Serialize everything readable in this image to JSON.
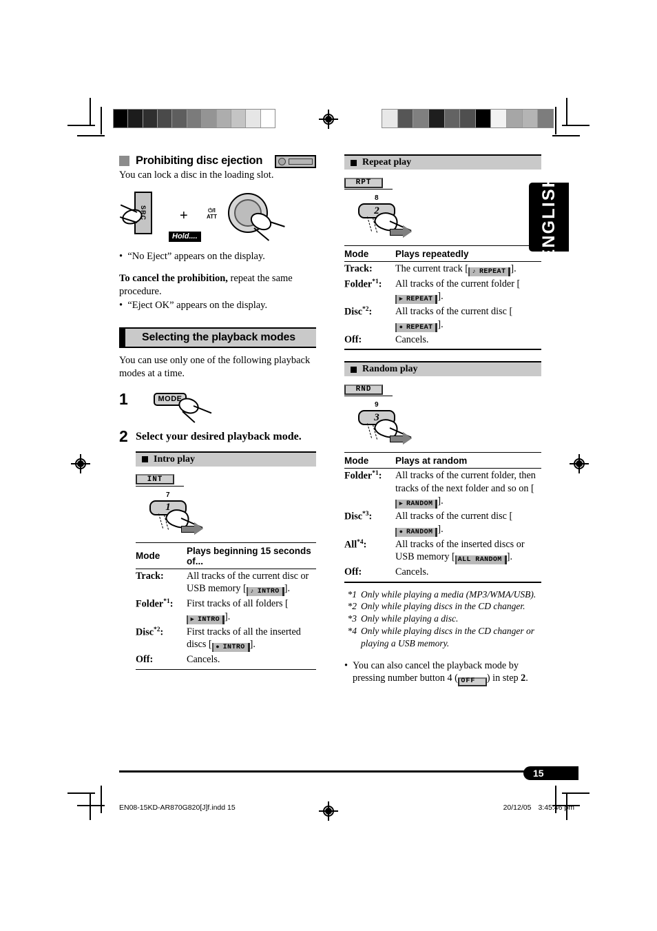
{
  "language_tab": "ENGLISH",
  "page_number": "15",
  "footer": {
    "filename": "EN08-15KD-AR870G820[J]f.indd   15",
    "date": "20/12/05",
    "time": "3:45:46 pm"
  },
  "left_column": {
    "section1": {
      "marker": "gray-square",
      "title": "Prohibiting disc ejection",
      "unit_icon": "car-stereo-unit-icon",
      "intro": "You can lock a disc in the loading slot.",
      "illustration": {
        "src_key": "SRC",
        "plus": "+",
        "hold_tag": "Hold....",
        "dial_label_line1": "⏻/I",
        "dial_label_line2": "ATT",
        "dial": "rotary-volume-dial"
      },
      "bullet1": "“No Eject” appears on the display.",
      "cancel_bold": "To cancel the prohibition,",
      "cancel_rest": " repeat the same procedure.",
      "bullet2": "“Eject OK” appears on the display."
    },
    "banner": "Selecting the playback modes",
    "banner_intro": "You can use only one of the following playback modes at a time.",
    "step1": {
      "number": "1",
      "key_label": "MODE"
    },
    "step2": {
      "number": "2",
      "text": "Select your desired playback mode."
    },
    "intro_play": {
      "subbar_label": "Intro play",
      "display_chip": "INT",
      "key_sup": "7",
      "key_label": "1",
      "table": {
        "header": [
          "Mode",
          "Plays beginning 15 seconds of..."
        ],
        "rows": [
          {
            "mode": "Track",
            "footnote": "",
            "text_before": "All tracks of the current disc or USB memory [",
            "badge_icon": "♪",
            "badge_text": "INTRO",
            "text_after": "]."
          },
          {
            "mode": "Folder",
            "footnote": "*1",
            "text_before": "First tracks of all folders [",
            "badge_icon": "▶",
            "badge_text": "INTRO",
            "text_after": "]."
          },
          {
            "mode": "Disc",
            "footnote": "*2",
            "text_before": "First tracks of all the inserted discs [",
            "badge_icon": "●",
            "badge_text": "INTRO",
            "text_after": "]."
          },
          {
            "mode": "Off",
            "footnote": "",
            "text_before": "Cancels.",
            "badge_icon": "",
            "badge_text": "",
            "text_after": ""
          }
        ]
      }
    }
  },
  "right_column": {
    "repeat_play": {
      "subbar_label": "Repeat play",
      "display_chip": "RPT",
      "key_sup": "8",
      "key_label": "2",
      "table": {
        "header": [
          "Mode",
          "Plays repeatedly"
        ],
        "rows": [
          {
            "mode": "Track",
            "footnote": "",
            "text_before": "The current track [",
            "badge_icon": "♪",
            "badge_text": "REPEAT",
            "text_after": "]."
          },
          {
            "mode": "Folder",
            "footnote": "*1",
            "text_before": "All tracks of the current folder [",
            "badge_icon": "▶",
            "badge_text": "REPEAT",
            "text_after": "]."
          },
          {
            "mode": "Disc",
            "footnote": "*2",
            "text_before": "All tracks of the current disc [",
            "badge_icon": "●",
            "badge_text": "REPEAT",
            "text_after": "]."
          },
          {
            "mode": "Off",
            "footnote": "",
            "text_before": "Cancels.",
            "badge_icon": "",
            "badge_text": "",
            "text_after": ""
          }
        ]
      }
    },
    "random_play": {
      "subbar_label": "Random play",
      "display_chip": "RND",
      "key_sup": "9",
      "key_label": "3",
      "table": {
        "header": [
          "Mode",
          "Plays at random"
        ],
        "rows": [
          {
            "mode": "Folder",
            "footnote": "*1",
            "text_before": "All tracks of the current folder, then tracks of the next folder and so on [",
            "badge_icon": "▶",
            "badge_text": "RANDOM",
            "text_after": "]."
          },
          {
            "mode": "Disc",
            "footnote": "*3",
            "text_before": "All tracks of the current disc [",
            "badge_icon": "●",
            "badge_text": "RANDOM",
            "text_after": "]."
          },
          {
            "mode": "All",
            "footnote": "*4",
            "text_before": "All tracks of the inserted discs or USB memory [",
            "badge_icon": "",
            "badge_text": "ALL RANDOM",
            "text_after": "]."
          },
          {
            "mode": "Off",
            "footnote": "",
            "text_before": "Cancels.",
            "badge_icon": "",
            "badge_text": "",
            "text_after": ""
          }
        ]
      }
    },
    "footnotes": [
      {
        "mark": "*1",
        "text": "Only while playing a media (MP3/WMA/USB)."
      },
      {
        "mark": "*2",
        "text": "Only while playing discs in the CD changer."
      },
      {
        "mark": "*3",
        "text": "Only while playing a disc."
      },
      {
        "mark": "*4",
        "text": "Only while playing discs in the CD changer or playing a USB memory."
      }
    ],
    "tip": {
      "before": "You can also cancel the playback mode by pressing number button 4 (",
      "chip": "OFF",
      "after_a": ") in step ",
      "step": "2",
      "after_b": "."
    }
  },
  "calibration": {
    "left_bar": [
      "#000000",
      "#1c1c1c",
      "#2f2f2f",
      "#4a4a4a",
      "#5e5e5e",
      "#7b7b7b",
      "#949494",
      "#adadad",
      "#c4c4c4",
      "#e6e6e6",
      "#ffffff"
    ],
    "right_bar": [
      "#e8e8e8",
      "#565656",
      "#808080",
      "#1e1e1e",
      "#636363",
      "#4f4f4f",
      "#000000",
      "#f2f2f2",
      "#a6a6a6",
      "#b4b4b4",
      "#7d7d7d"
    ]
  }
}
